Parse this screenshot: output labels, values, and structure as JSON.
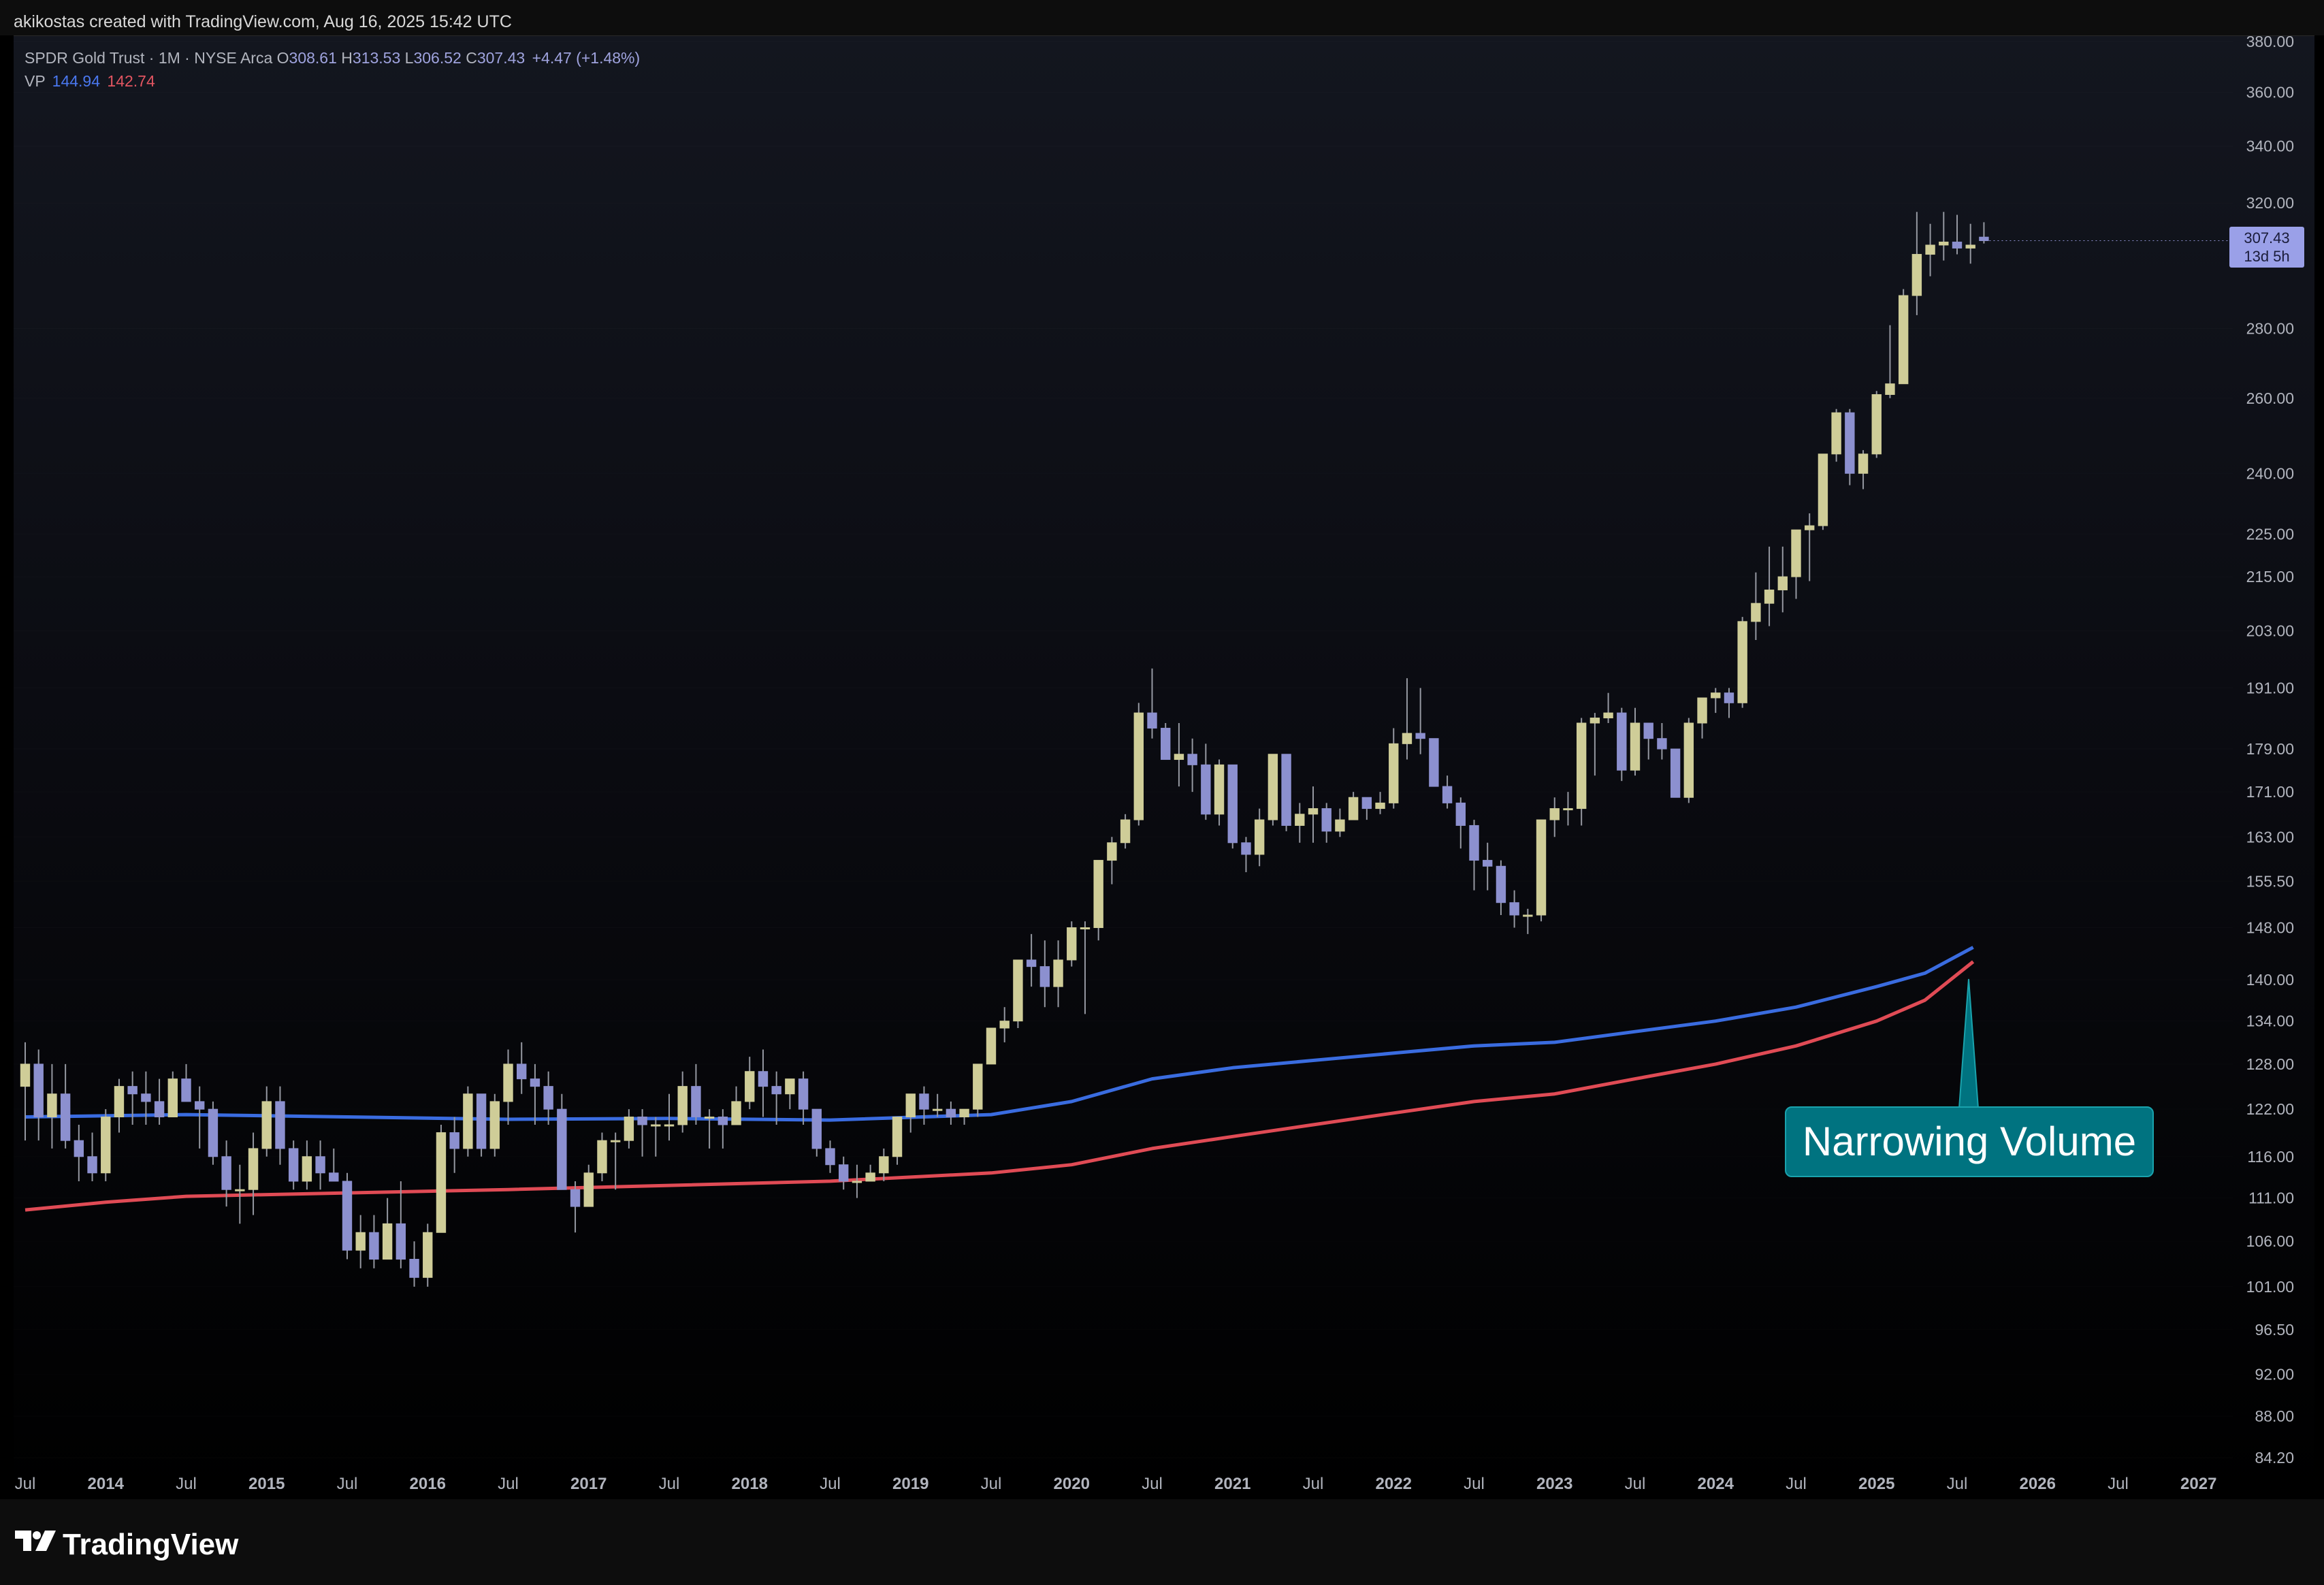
{
  "header": {
    "attribution": "akikostas created with TradingView.com, Aug 16, 2025 15:42 UTC"
  },
  "legend": {
    "symbol": "SPDR Gold Trust · 1M · NYSE Arca",
    "open_label": "O",
    "open": "308.61",
    "high_label": "H",
    "high": "313.53",
    "low_label": "L",
    "low": "306.52",
    "close_label": "C",
    "close": "307.43",
    "change": "+4.47 (+1.48%)",
    "vp_label": "VP",
    "vp_val1": "144.94",
    "vp_val2": "142.74"
  },
  "price_tag": {
    "price": "307.43",
    "countdown": "13d 5h"
  },
  "annotation": {
    "text": "Narrowing Volume"
  },
  "footer": {
    "brand": "TradingView"
  },
  "colors": {
    "bull": "#cfcd98",
    "bear": "#8c90cf",
    "wick": "#9598a1",
    "vp_blue": "#3a6ce0",
    "vp_red": "#e04b55",
    "annotation": "#007380",
    "axis_text": "#b2b5be"
  },
  "chart_data": {
    "type": "candlestick",
    "interval": "1M",
    "scale": "log",
    "ylim": [
      82,
      383
    ],
    "y_ticks": [
      "380.00",
      "360.00",
      "340.00",
      "320.00",
      "280.00",
      "260.00",
      "240.00",
      "225.00",
      "215.00",
      "203.00",
      "191.00",
      "179.00",
      "171.00",
      "163.00",
      "155.50",
      "148.00",
      "140.00",
      "134.00",
      "128.00",
      "122.00",
      "116.00",
      "111.00",
      "106.00",
      "101.00",
      "96.50",
      "92.00",
      "88.00",
      "84.20"
    ],
    "x_ticks": [
      "Jul",
      "2014",
      "Jul",
      "2015",
      "Jul",
      "2016",
      "Jul",
      "2017",
      "Jul",
      "2018",
      "Jul",
      "2019",
      "Jul",
      "2020",
      "Jul",
      "2021",
      "Jul",
      "2022",
      "Jul",
      "2023",
      "Jul",
      "2024",
      "Jul",
      "2025",
      "Jul",
      "2026",
      "Jul",
      "2027"
    ],
    "x_range": [
      "2013-07",
      "2027-04"
    ],
    "ohlc_monthly_from_2013_07": [
      [
        125,
        131,
        118,
        128
      ],
      [
        128,
        130,
        118,
        121
      ],
      [
        121,
        128,
        117,
        124
      ],
      [
        124,
        128,
        117,
        118
      ],
      [
        118,
        120,
        113,
        116
      ],
      [
        116,
        119,
        113,
        114
      ],
      [
        114,
        122,
        113,
        121
      ],
      [
        121,
        126,
        119,
        125
      ],
      [
        125,
        127,
        120,
        124
      ],
      [
        124,
        127,
        120,
        123
      ],
      [
        123,
        126,
        120,
        121
      ],
      [
        121,
        127,
        121,
        126
      ],
      [
        126,
        128,
        123,
        123
      ],
      [
        123,
        125,
        117,
        122
      ],
      [
        122,
        123,
        115,
        116
      ],
      [
        116,
        118,
        110,
        112
      ],
      [
        112,
        115,
        108,
        112
      ],
      [
        112,
        119,
        109,
        117
      ],
      [
        117,
        125,
        116,
        123
      ],
      [
        123,
        125,
        115,
        117
      ],
      [
        117,
        118,
        112,
        113
      ],
      [
        113,
        118,
        112,
        116
      ],
      [
        116,
        118,
        112,
        114
      ],
      [
        114,
        117,
        113,
        113
      ],
      [
        113,
        114,
        104,
        105
      ],
      [
        105,
        109,
        103,
        107
      ],
      [
        107,
        109,
        103,
        104
      ],
      [
        104,
        111,
        104,
        108
      ],
      [
        108,
        113,
        103,
        104
      ],
      [
        104,
        106,
        101,
        102
      ],
      [
        102,
        108,
        101,
        107
      ],
      [
        107,
        120,
        107,
        119
      ],
      [
        119,
        121,
        114,
        117
      ],
      [
        117,
        125,
        116,
        124
      ],
      [
        124,
        124,
        116,
        117
      ],
      [
        117,
        124,
        116,
        123
      ],
      [
        123,
        130,
        120,
        128
      ],
      [
        128,
        131,
        124,
        126
      ],
      [
        126,
        128,
        120,
        125
      ],
      [
        125,
        127,
        120,
        122
      ],
      [
        122,
        124,
        112,
        112
      ],
      [
        112,
        113,
        107,
        110
      ],
      [
        110,
        115,
        110,
        114
      ],
      [
        114,
        119,
        113,
        118
      ],
      [
        118,
        119,
        112,
        118
      ],
      [
        118,
        122,
        117,
        121
      ],
      [
        121,
        122,
        116,
        120
      ],
      [
        120,
        121,
        116,
        120
      ],
      [
        120,
        124,
        118,
        120
      ],
      [
        120,
        127,
        119,
        125
      ],
      [
        125,
        128,
        120,
        121
      ],
      [
        121,
        122,
        117,
        121
      ],
      [
        121,
        122,
        117,
        120
      ],
      [
        120,
        125,
        120,
        123
      ],
      [
        123,
        129,
        122,
        127
      ],
      [
        127,
        130,
        121,
        125
      ],
      [
        125,
        127,
        120,
        124
      ],
      [
        124,
        126,
        122,
        126
      ],
      [
        126,
        127,
        120,
        122
      ],
      [
        122,
        122,
        116,
        117
      ],
      [
        117,
        118,
        114,
        115
      ],
      [
        115,
        116,
        112,
        113
      ],
      [
        113,
        115,
        111,
        113
      ],
      [
        113,
        115,
        113,
        114
      ],
      [
        114,
        117,
        113,
        116
      ],
      [
        116,
        121,
        115,
        121
      ],
      [
        121,
        124,
        119,
        124
      ],
      [
        124,
        125,
        120,
        122
      ],
      [
        122,
        124,
        121,
        122
      ],
      [
        122,
        123,
        120,
        121
      ],
      [
        121,
        122,
        120,
        122
      ],
      [
        122,
        128,
        121,
        128
      ],
      [
        128,
        133,
        128,
        133
      ],
      [
        133,
        136,
        131,
        134
      ],
      [
        134,
        143,
        133,
        143
      ],
      [
        143,
        147,
        139,
        142
      ],
      [
        142,
        146,
        136,
        139
      ],
      [
        139,
        146,
        136,
        143
      ],
      [
        143,
        149,
        142,
        148
      ],
      [
        148,
        149,
        135,
        148
      ],
      [
        148,
        159,
        146,
        159
      ],
      [
        159,
        163,
        155,
        162
      ],
      [
        162,
        167,
        161,
        166
      ],
      [
        166,
        188,
        165,
        186
      ],
      [
        186,
        195,
        181,
        183
      ],
      [
        183,
        184,
        177,
        177
      ],
      [
        177,
        184,
        172,
        178
      ],
      [
        178,
        181,
        171,
        176
      ],
      [
        176,
        180,
        166,
        167
      ],
      [
        167,
        177,
        165,
        176
      ],
      [
        176,
        176,
        161,
        162
      ],
      [
        162,
        163,
        157,
        160
      ],
      [
        160,
        168,
        158,
        166
      ],
      [
        166,
        178,
        165,
        178
      ],
      [
        178,
        178,
        164,
        165
      ],
      [
        165,
        169,
        162,
        167
      ],
      [
        167,
        172,
        162,
        168
      ],
      [
        168,
        169,
        162,
        164
      ],
      [
        164,
        168,
        163,
        166
      ],
      [
        166,
        171,
        166,
        170
      ],
      [
        170,
        170,
        166,
        168
      ],
      [
        168,
        171,
        167,
        169
      ],
      [
        169,
        183,
        168,
        180
      ],
      [
        180,
        193,
        177,
        182
      ],
      [
        182,
        191,
        178,
        181
      ],
      [
        181,
        181,
        172,
        172
      ],
      [
        172,
        174,
        168,
        169
      ],
      [
        169,
        170,
        161,
        165
      ],
      [
        165,
        166,
        154,
        159
      ],
      [
        159,
        162,
        154,
        158
      ],
      [
        158,
        159,
        150,
        152
      ],
      [
        152,
        154,
        148,
        150
      ],
      [
        150,
        151,
        147,
        150
      ],
      [
        150,
        166,
        149,
        166
      ],
      [
        166,
        170,
        163,
        168
      ],
      [
        168,
        171,
        165,
        168
      ],
      [
        168,
        185,
        165,
        184
      ],
      [
        184,
        186,
        174,
        185
      ],
      [
        185,
        190,
        184,
        186
      ],
      [
        186,
        187,
        173,
        175
      ],
      [
        175,
        187,
        174,
        184
      ],
      [
        184,
        184,
        177,
        181
      ],
      [
        181,
        184,
        177,
        179
      ],
      [
        179,
        179,
        170,
        170
      ],
      [
        170,
        185,
        169,
        184
      ],
      [
        184,
        189,
        181,
        189
      ],
      [
        189,
        191,
        186,
        190
      ],
      [
        190,
        191,
        185,
        188
      ],
      [
        188,
        206,
        187,
        205
      ],
      [
        205,
        216,
        201,
        209
      ],
      [
        209,
        222,
        204,
        212
      ],
      [
        212,
        222,
        207,
        215
      ],
      [
        215,
        225,
        210,
        226
      ],
      [
        226,
        230,
        214,
        227
      ],
      [
        227,
        245,
        226,
        245
      ],
      [
        245,
        257,
        243,
        256
      ],
      [
        256,
        257,
        237,
        240
      ],
      [
        240,
        246,
        236,
        245
      ],
      [
        245,
        262,
        244,
        261
      ],
      [
        261,
        281,
        260,
        264
      ],
      [
        264,
        292,
        269,
        290
      ],
      [
        290,
        317,
        284,
        303
      ],
      [
        303,
        313,
        296,
        306
      ],
      [
        306,
        317,
        301,
        307
      ],
      [
        307,
        316,
        303,
        305
      ],
      [
        305,
        313,
        300,
        306
      ],
      [
        308.61,
        313.53,
        306.52,
        307.43
      ]
    ],
    "series": [
      {
        "name": "VP",
        "value_last": 144.94,
        "color": "blue",
        "points_yearly": [
          [
            2013.5,
            121
          ],
          [
            2014.5,
            121.3
          ],
          [
            2015.5,
            121
          ],
          [
            2016.5,
            120.7
          ],
          [
            2017.5,
            120.8
          ],
          [
            2018.5,
            120.6
          ],
          [
            2019.5,
            121.3
          ],
          [
            2020.0,
            123
          ],
          [
            2020.5,
            126
          ],
          [
            2021.0,
            127.5
          ],
          [
            2021.5,
            128.5
          ],
          [
            2022.0,
            129.5
          ],
          [
            2022.5,
            130.5
          ],
          [
            2023.0,
            131
          ],
          [
            2023.5,
            132.5
          ],
          [
            2024.0,
            134
          ],
          [
            2024.5,
            136
          ],
          [
            2025.0,
            139
          ],
          [
            2025.3,
            141
          ],
          [
            2025.6,
            144.94
          ]
        ]
      },
      {
        "name": "VP",
        "value_last": 142.74,
        "color": "red",
        "points_yearly": [
          [
            2013.5,
            109.6
          ],
          [
            2014.0,
            110.5
          ],
          [
            2014.5,
            111.2
          ],
          [
            2015.5,
            111.6
          ],
          [
            2016.5,
            112
          ],
          [
            2017.5,
            112.5
          ],
          [
            2018.5,
            113
          ],
          [
            2019.5,
            114
          ],
          [
            2020.0,
            115
          ],
          [
            2020.5,
            117
          ],
          [
            2021.0,
            118.5
          ],
          [
            2021.5,
            120
          ],
          [
            2022.0,
            121.5
          ],
          [
            2022.5,
            123
          ],
          [
            2023.0,
            124
          ],
          [
            2023.5,
            126
          ],
          [
            2024.0,
            128
          ],
          [
            2024.5,
            130.5
          ],
          [
            2025.0,
            134
          ],
          [
            2025.3,
            137
          ],
          [
            2025.6,
            142.74
          ]
        ]
      }
    ]
  }
}
